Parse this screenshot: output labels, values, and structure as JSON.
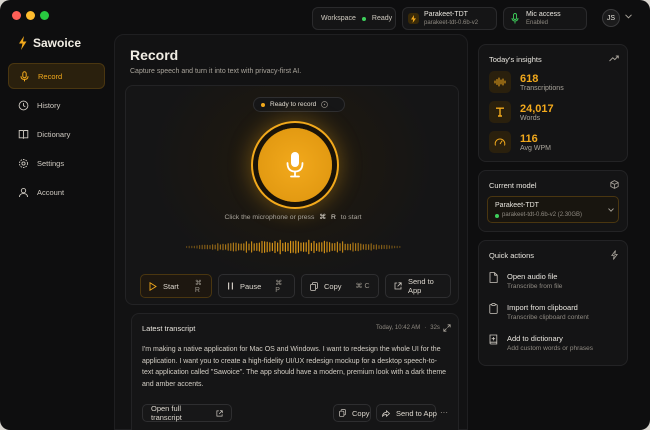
{
  "titlebar": {
    "workspace_label": "Workspace",
    "workspace_status": "Ready",
    "model_name": "Parakeet-TDT",
    "model_version": "parakeet-tdt-0.6b-v2",
    "mic_label": "Mic access",
    "mic_status": "Enabled",
    "user_initials": "JS"
  },
  "app": {
    "name": "Sawoice"
  },
  "sidebar": {
    "items": [
      {
        "label": "Record",
        "icon": "mic-icon"
      },
      {
        "label": "History",
        "icon": "history-icon"
      },
      {
        "label": "Dictionary",
        "icon": "book-icon"
      },
      {
        "label": "Settings",
        "icon": "gear-icon"
      },
      {
        "label": "Account",
        "icon": "user-icon"
      }
    ]
  },
  "record": {
    "title": "Record",
    "subtitle": "Capture speech and turn it into text with privacy-first AI.",
    "status": "Ready to record",
    "hint_pre": "Click the microphone or press",
    "hint_key1": "⌘",
    "hint_key2": "R",
    "hint_post": "to start"
  },
  "actions": {
    "start_label": "Start",
    "start_kbd": "⌘ R",
    "pause_label": "Pause",
    "pause_kbd": "⌘ P",
    "copy_label": "Copy",
    "copy_kbd": "⌘ C",
    "send_label": "Send to App"
  },
  "transcript": {
    "heading": "Latest transcript",
    "meta": "Today, 10:42 AM",
    "duration": "32s",
    "text": "I'm making a native application for Mac OS and Windows. I want to redesign the whole UI for the application. I want you to create a high-fidelity UI/UX redesign mockup for a desktop speech-to-text application called \"Sawoice\". The app should have a modern, premium look with a dark theme and amber accents.",
    "open_label": "Open full transcript",
    "copy_label": "Copy",
    "send_label": "Send to App",
    "more_label": "···"
  },
  "insights": {
    "heading": "Today's insights",
    "items": [
      {
        "value": "618",
        "label": "Transcriptions",
        "icon": "waveform-icon"
      },
      {
        "value": "24,017",
        "label": "Words",
        "icon": "text-icon"
      },
      {
        "value": "116",
        "label": "Avg WPM",
        "icon": "speedometer-icon"
      }
    ]
  },
  "current_model": {
    "heading": "Current model",
    "name": "Parakeet-TDT",
    "detail": "parakeet-tdt-0.6b-v2 (2.30GB)"
  },
  "quick_actions": {
    "heading": "Quick actions",
    "items": [
      {
        "title": "Open audio file",
        "sub": "Transcribe from file",
        "icon": "file-icon"
      },
      {
        "title": "Import from clipboard",
        "sub": "Transcribe clipboard content",
        "icon": "clipboard-icon"
      },
      {
        "title": "Add to dictionary",
        "sub": "Add custom words or phrases",
        "icon": "book-plus-icon"
      }
    ]
  },
  "colors": {
    "accent": "#f2a91c",
    "background": "#0e0e0f",
    "status_green": "#3ecf5b"
  }
}
